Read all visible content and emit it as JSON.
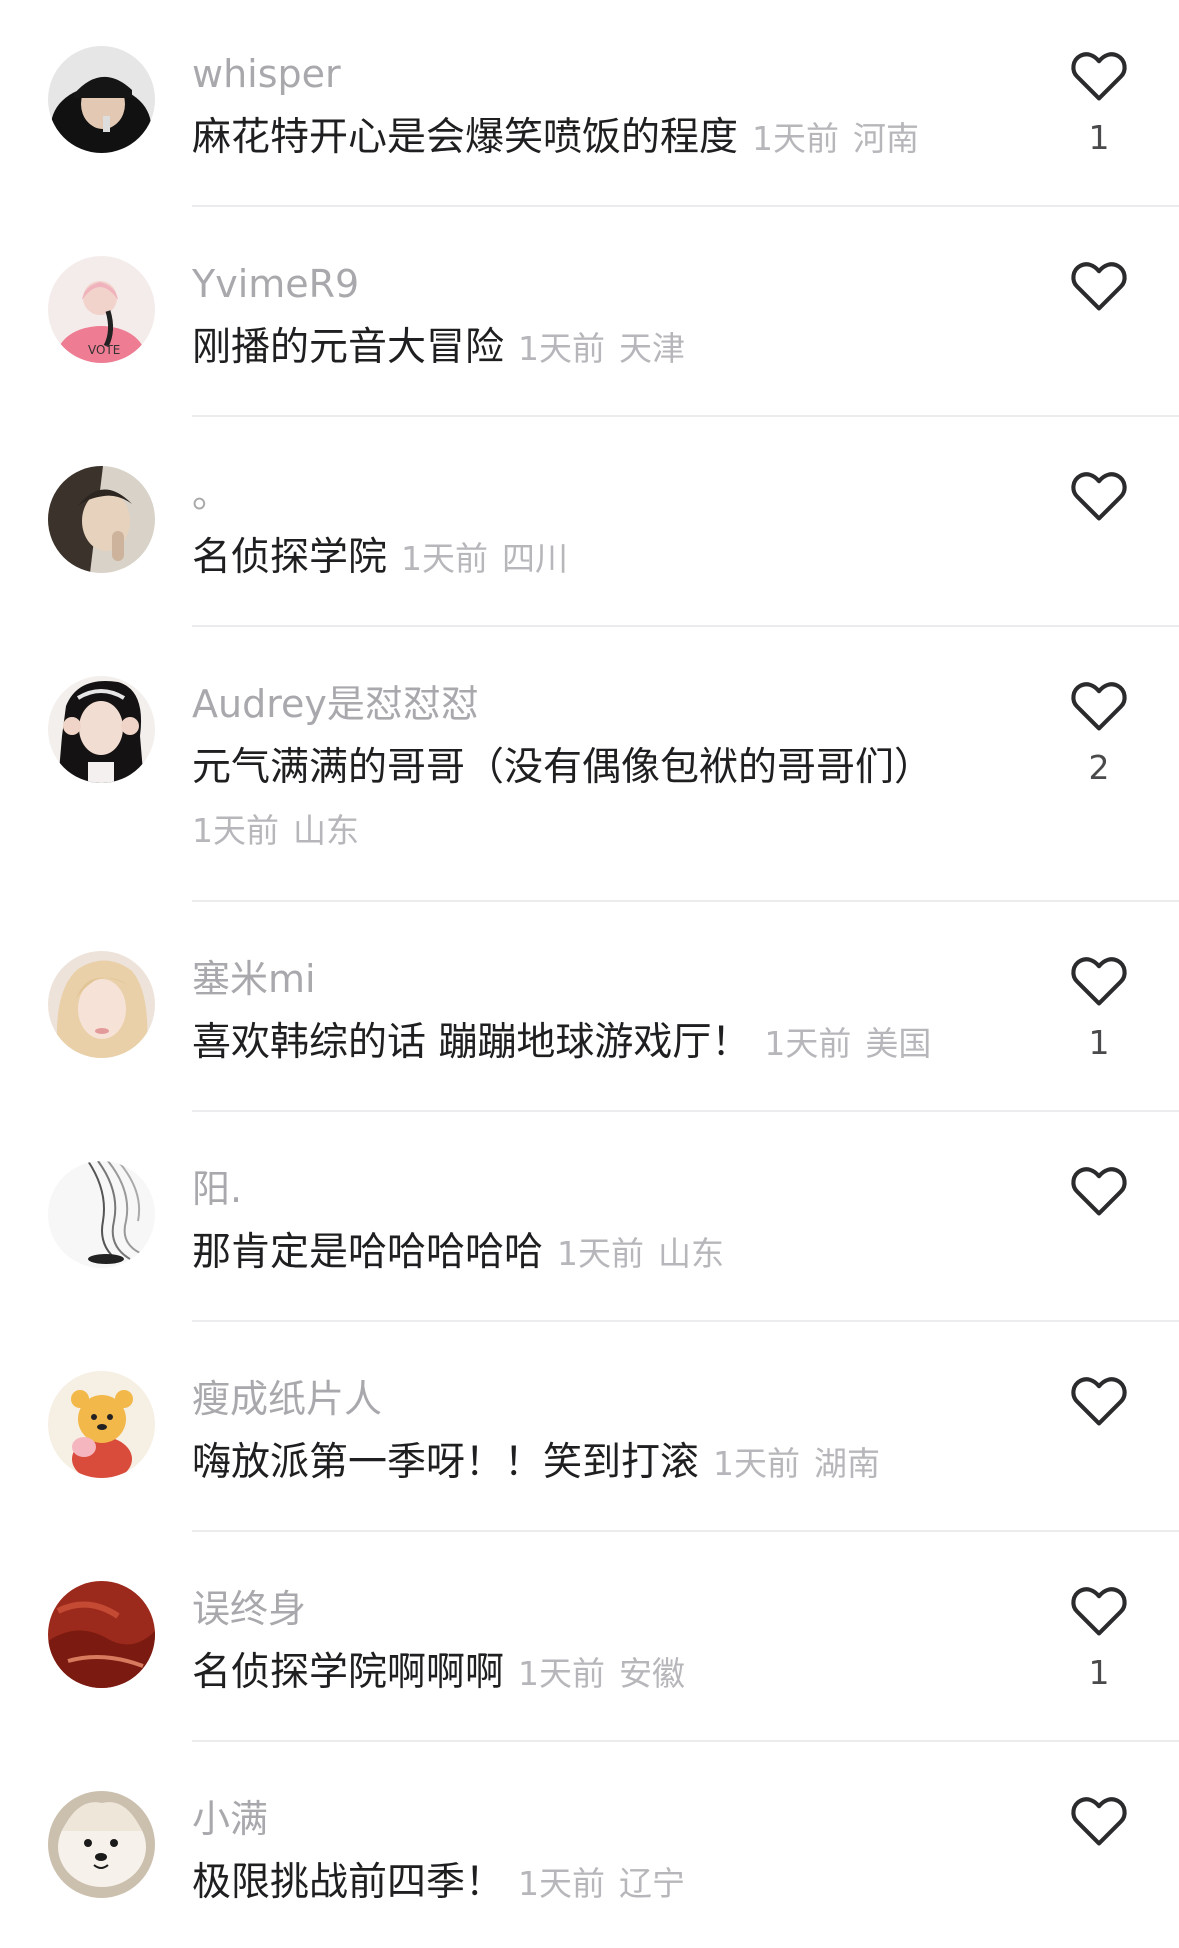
{
  "comments": [
    {
      "username": "whisper",
      "text": "麻花特开心是会爆笑喷饭的程度",
      "time": "1天前",
      "location": "河南",
      "likes": "1"
    },
    {
      "username": "YvimeR9",
      "text": "刚播的元音大冒险",
      "time": "1天前",
      "location": "天津",
      "likes": ""
    },
    {
      "username": "。",
      "text": "名侦探学院",
      "time": "1天前",
      "location": "四川",
      "likes": ""
    },
    {
      "username": "Audrey是怼怼怼",
      "text": "元气满满的哥哥（没有偶像包袱的哥哥们）",
      "time": "1天前",
      "location": "山东",
      "likes": "2"
    },
    {
      "username": "塞米mi",
      "text": "喜欢韩综的话 蹦蹦地球游戏厅！",
      "time": "1天前",
      "location": "美国",
      "likes": "1"
    },
    {
      "username": "阳.",
      "text": "那肯定是哈哈哈哈哈",
      "time": "1天前",
      "location": "山东",
      "likes": ""
    },
    {
      "username": "瘦成纸片人",
      "text": "嗨放派第一季呀！！笑到打滚",
      "time": "1天前",
      "location": "湖南",
      "likes": ""
    },
    {
      "username": "误终身",
      "text": "名侦探学院啊啊啊",
      "time": "1天前",
      "location": "安徽",
      "likes": "1"
    },
    {
      "username": "小满",
      "text": "极限挑战前四季！",
      "time": "1天前",
      "location": "辽宁",
      "likes": ""
    }
  ],
  "icons": {
    "like": "heart-outline-icon"
  },
  "colors": {
    "username": "#a9a9ad",
    "text": "#1f1f22",
    "meta": "#b7b7bb",
    "divider": "#ececee"
  }
}
